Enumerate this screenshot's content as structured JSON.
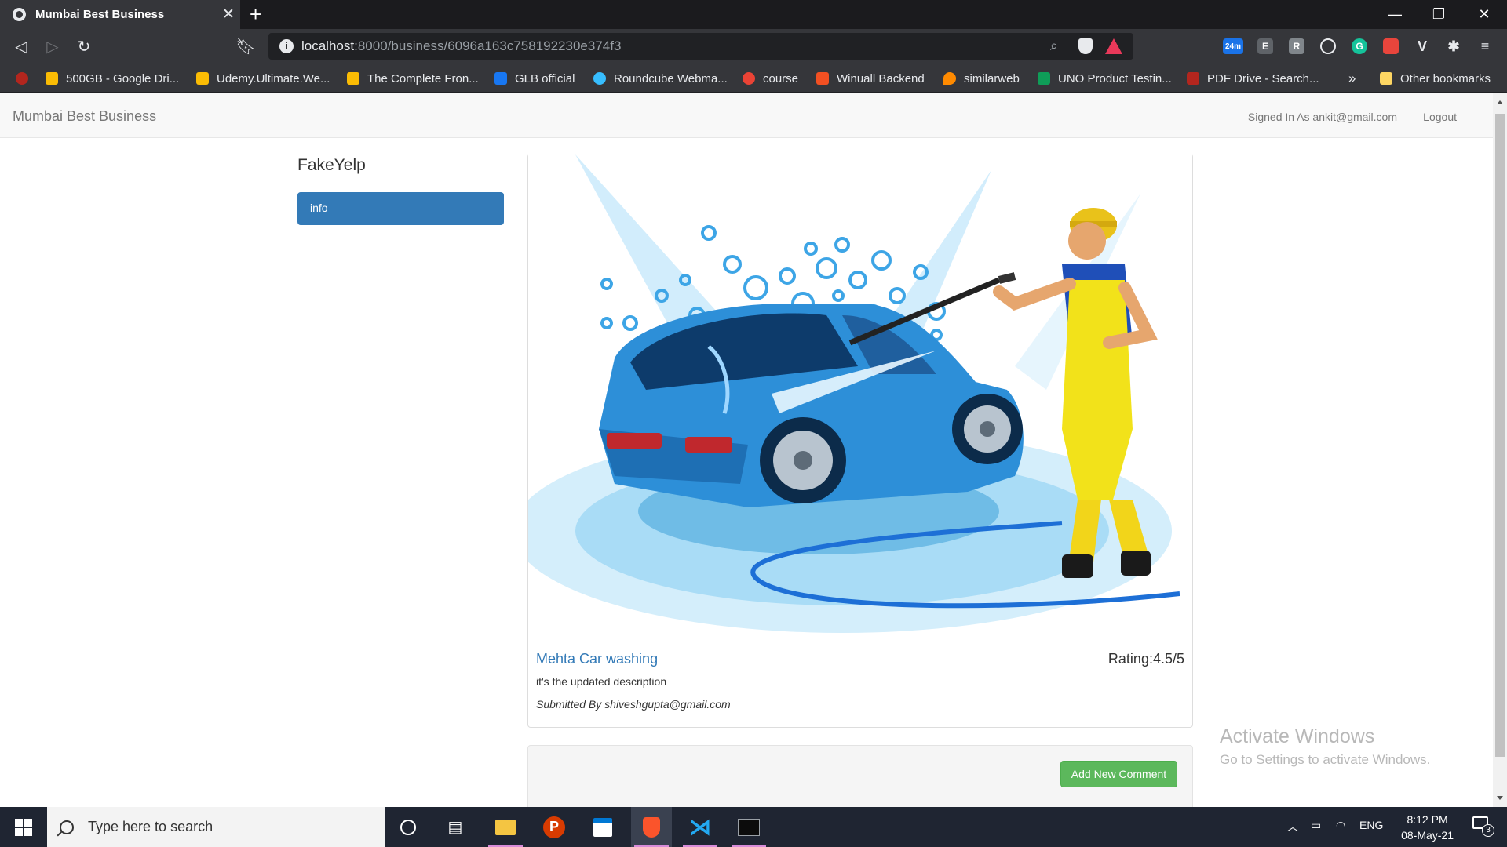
{
  "browser": {
    "tab_title": "Mumbai Best Business",
    "new_tab": "+",
    "url_host": "localhost",
    "url_path": ":8000/business/6096a163c758192230e374f3",
    "extension_badge": "24m",
    "bookmarks": [
      {
        "label": "500GB - Google Dri...",
        "icon": "google-drive-icon",
        "color": "#fbbc04"
      },
      {
        "label": "Udemy.Ultimate.We...",
        "icon": "google-drive-icon",
        "color": "#fbbc04"
      },
      {
        "label": "The Complete Fron...",
        "icon": "google-drive-icon",
        "color": "#fbbc04"
      },
      {
        "label": "GLB official",
        "icon": "facebook-icon",
        "color": "#1877f2"
      },
      {
        "label": "Roundcube Webma...",
        "icon": "roundcube-icon",
        "color": "#37beff"
      },
      {
        "label": "course",
        "icon": "gmail-icon",
        "color": "#ea4335"
      },
      {
        "label": "Winuall Backend",
        "icon": "winuall-icon",
        "color": "#f25022"
      },
      {
        "label": "similarweb",
        "icon": "similarweb-icon",
        "color": "#ff8a00"
      },
      {
        "label": "UNO Product Testin...",
        "icon": "sheets-icon",
        "color": "#0f9d58"
      },
      {
        "label": "PDF Drive - Search...",
        "icon": "pdfdrive-icon",
        "color": "#b3261e"
      }
    ],
    "more_bookmarks": "»",
    "other_bookmarks": "Other bookmarks"
  },
  "navbar": {
    "brand": "Mumbai Best Business",
    "signed_in": "Signed In As ankit@gmail.com",
    "logout": "Logout"
  },
  "sidebar": {
    "title": "FakeYelp",
    "items": [
      {
        "label": "info"
      }
    ]
  },
  "business": {
    "name": "Mehta Car washing",
    "rating": "Rating:4.5/5",
    "description": "it's the updated description",
    "submitted_by": "Submitted By shiveshgupta@gmail.com"
  },
  "comments": {
    "add_button": "Add New Comment"
  },
  "watermark": {
    "line1": "Activate Windows",
    "line2": "Go to Settings to activate Windows."
  },
  "taskbar": {
    "search_placeholder": "Type here to search",
    "language": "ENG",
    "time": "8:12 PM",
    "date": "08-May-21",
    "notification_count": "3"
  },
  "colors": {
    "primary": "#337ab7",
    "success": "#5cb85c",
    "link": "#337ab7"
  }
}
